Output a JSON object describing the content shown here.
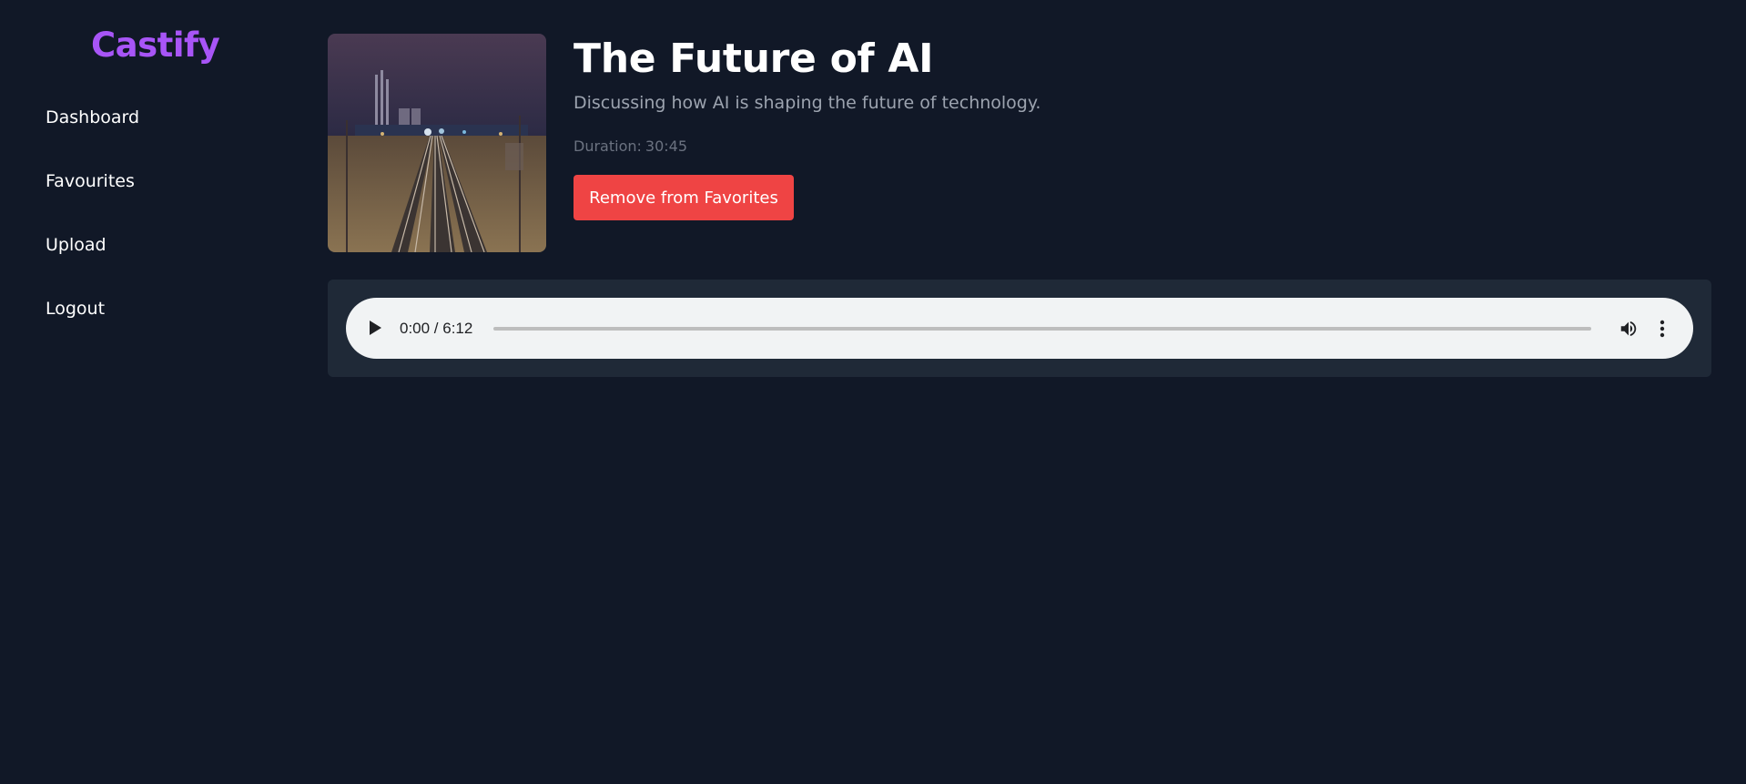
{
  "app": {
    "brand": "Castify",
    "brand_color": "#a855f7",
    "background": "#111827"
  },
  "sidebar": {
    "items": [
      {
        "label": "Dashboard"
      },
      {
        "label": "Favourites"
      },
      {
        "label": "Upload"
      },
      {
        "label": "Logout"
      }
    ]
  },
  "podcast": {
    "title": "The Future of AI",
    "description": "Discussing how AI is shaping the future of technology.",
    "duration_label": "Duration:",
    "duration_value": "30:45",
    "cover_image": "night-railway-tracks-cityscape",
    "favorite_button": "Remove from Favorites",
    "favorite_color": "#ef4444"
  },
  "player": {
    "play_icon": "play-icon",
    "time_display": "0:00 / 6:12",
    "progress": 0.0,
    "volume_icon": "volume-icon",
    "more_icon": "more-vertical-icon"
  }
}
